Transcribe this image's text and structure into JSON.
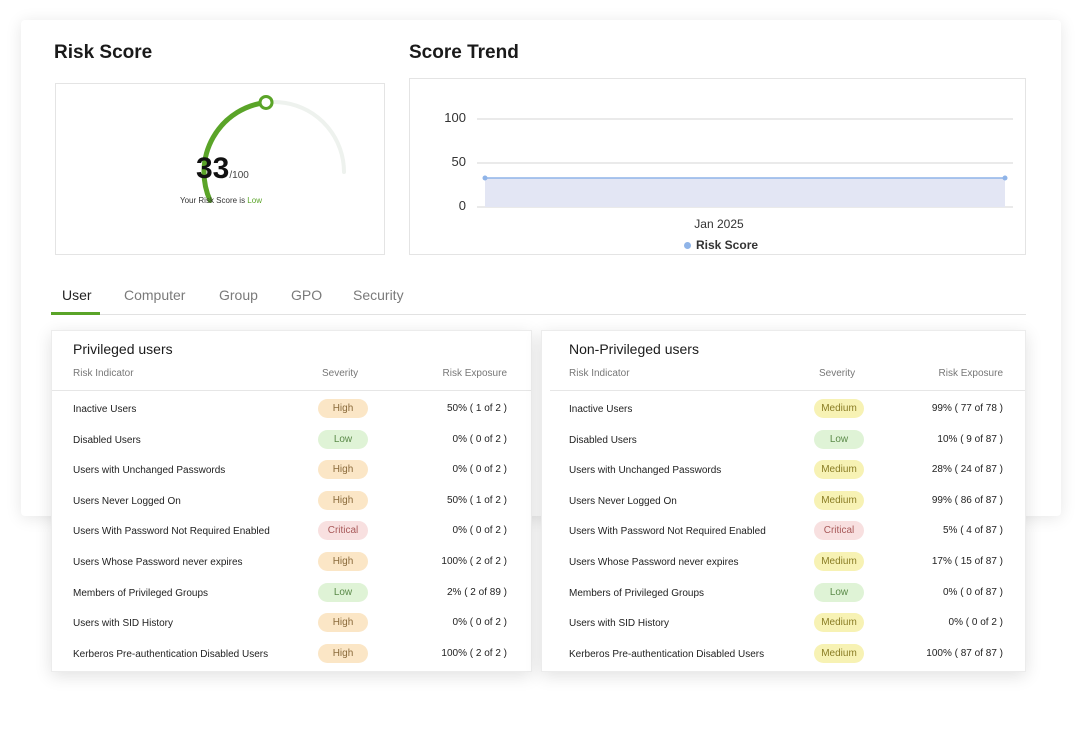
{
  "risk_score": {
    "title": "Risk Score",
    "score": "33",
    "denominator": "/100",
    "caption_prefix": "Your Risk Score is ",
    "level": "Low",
    "gauge_fraction": 0.33,
    "colors": {
      "arc": "#5aa428",
      "track": "#eef2ee",
      "knob": "#5aa428"
    }
  },
  "score_trend": {
    "title": "Score Trend",
    "legend": "Risk Score",
    "colors": {
      "line": "#8fb4e8",
      "fill": "#e3e6f4",
      "grid": "#d4d4d4"
    }
  },
  "chart_data": {
    "type": "area",
    "x": [
      "Jan 2025"
    ],
    "yticks": [
      "0",
      "50",
      "100"
    ],
    "ylim": [
      0,
      100
    ],
    "series": [
      {
        "name": "Risk Score",
        "values": [
          33
        ]
      }
    ],
    "grid": true,
    "legend_position": "bottom"
  },
  "tabs": [
    {
      "label": "User",
      "active": true
    },
    {
      "label": "Computer",
      "active": false
    },
    {
      "label": "Group",
      "active": false
    },
    {
      "label": "GPO",
      "active": false
    },
    {
      "label": "Security",
      "active": false
    }
  ],
  "privileged": {
    "title": "Privileged users",
    "headers": {
      "indicator": "Risk Indicator",
      "severity": "Severity",
      "exposure": "Risk Exposure"
    },
    "rows": [
      {
        "indicator": "Inactive Users",
        "severity": "High",
        "exposure": "50% ( 1 of 2 )"
      },
      {
        "indicator": "Disabled Users",
        "severity": "Low",
        "exposure": "0% ( 0 of 2 )"
      },
      {
        "indicator": "Users with Unchanged Passwords",
        "severity": "High",
        "exposure": "0% ( 0 of 2 )"
      },
      {
        "indicator": "Users Never Logged On",
        "severity": "High",
        "exposure": "50% ( 1 of 2 )"
      },
      {
        "indicator": "Users With Password Not Required Enabled",
        "severity": "Critical",
        "exposure": "0% ( 0 of 2 )"
      },
      {
        "indicator": "Users Whose Password never expires",
        "severity": "High",
        "exposure": "100% ( 2 of 2 )"
      },
      {
        "indicator": "Members of Privileged Groups",
        "severity": "Low",
        "exposure": "2% ( 2 of 89 )"
      },
      {
        "indicator": "Users with SID History",
        "severity": "High",
        "exposure": "0% ( 0 of 2 )"
      },
      {
        "indicator": "Kerberos Pre-authentication Disabled Users",
        "severity": "High",
        "exposure": "100% ( 2 of 2 )"
      }
    ]
  },
  "non_privileged": {
    "title": "Non-Privileged users",
    "headers": {
      "indicator": "Risk Indicator",
      "severity": "Severity",
      "exposure": "Risk Exposure"
    },
    "rows": [
      {
        "indicator": "Inactive Users",
        "severity": "Medium",
        "exposure": "99% ( 77 of 78 )"
      },
      {
        "indicator": "Disabled Users",
        "severity": "Low",
        "exposure": "10% ( 9 of 87 )"
      },
      {
        "indicator": "Users with Unchanged Passwords",
        "severity": "Medium",
        "exposure": "28% ( 24 of 87 )"
      },
      {
        "indicator": "Users Never Logged On",
        "severity": "Medium",
        "exposure": "99% ( 86 of 87 )"
      },
      {
        "indicator": "Users With Password Not Required Enabled",
        "severity": "Critical",
        "exposure": "5% ( 4 of 87 )"
      },
      {
        "indicator": "Users Whose Password never expires",
        "severity": "Medium",
        "exposure": "17% ( 15 of 87 )"
      },
      {
        "indicator": "Members of Privileged Groups",
        "severity": "Low",
        "exposure": "0% ( 0 of 87 )"
      },
      {
        "indicator": "Users with SID History",
        "severity": "Medium",
        "exposure": "0% ( 0 of 2 )"
      },
      {
        "indicator": "Kerberos Pre-authentication Disabled Users",
        "severity": "Medium",
        "exposure": "100% ( 87 of 87 )"
      }
    ]
  }
}
